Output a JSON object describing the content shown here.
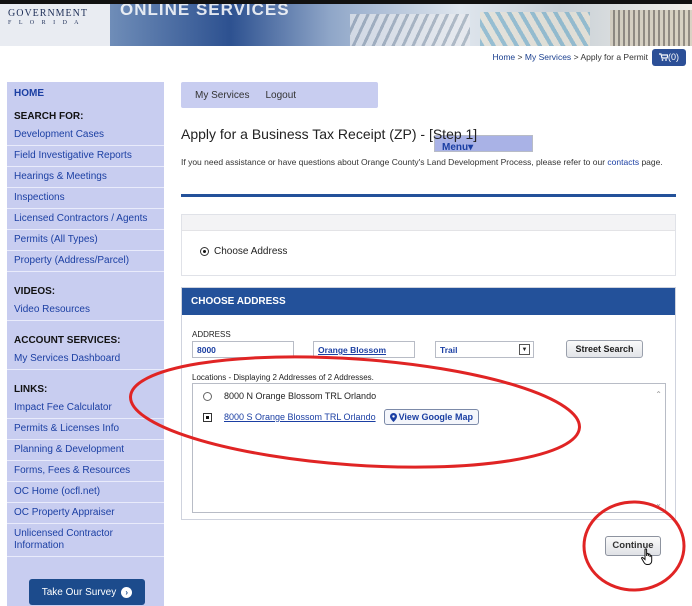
{
  "banner": {
    "logo_line1": "GOVERNMENT",
    "logo_line2": "F L O R I D A",
    "title": "ONLINE SERVICES"
  },
  "breadcrumb": {
    "home": "Home",
    "sep1": ">",
    "services": "My Services",
    "sep2": ">",
    "current": "Apply for a Permit"
  },
  "cart": {
    "label": "(0)",
    "icon": "cart-icon"
  },
  "sidebar": {
    "home": "HOME",
    "search_heading": "SEARCH FOR:",
    "search_links": [
      "Development Cases",
      "Field Investigative Reports",
      "Hearings & Meetings",
      "Inspections",
      "Licensed Contractors / Agents",
      "Permits (All Types)",
      "Property (Address/Parcel)"
    ],
    "videos_heading": "VIDEOS:",
    "video_links": [
      "Video Resources"
    ],
    "account_heading": "ACCOUNT SERVICES:",
    "account_links": [
      "My Services Dashboard"
    ],
    "links_heading": "LINKS:",
    "links": [
      "Impact Fee Calculator",
      "Permits & Licenses Info",
      "Planning & Development",
      "Forms, Fees & Resources",
      "OC Home (ocfl.net)",
      "OC Property Appraiser",
      "Unlicensed Contractor Information"
    ],
    "survey_label": "Take Our Survey"
  },
  "menu": {
    "my_services": "My Services",
    "menu": "Menu",
    "menu_caret": "▾",
    "logout": "Logout"
  },
  "page": {
    "title": "Apply for a Business Tax Receipt (ZP) - [Step 1]",
    "help_prefix": "If you need assistance or have questions about Orange County's Land Development Process, please refer to our",
    "help_link": "contacts",
    "help_suffix": "page.",
    "choose_address_option": "Choose Address"
  },
  "address_panel": {
    "header": "CHOOSE ADDRESS",
    "address_label": "ADDRESS",
    "street_number": "8000",
    "street_name": "Orange Blossom",
    "street_type": "Trail",
    "street_search_label": "Street Search",
    "locations_label": "Locations - Displaying 2 Addresses of 2 Addresses.",
    "locations": [
      {
        "text": "8000 N Orange Blossom TRL Orlando",
        "selected": false
      },
      {
        "text": "8000 S Orange Blossom TRL Orlando",
        "selected": true
      }
    ],
    "map_button": "View Google Map"
  },
  "continue_label": "Continue",
  "colors": {
    "sidebar_bg": "#c8cdf0",
    "panel_header": "#23519a",
    "annotation_red": "#e02424",
    "link_blue": "#1b3fa3"
  }
}
